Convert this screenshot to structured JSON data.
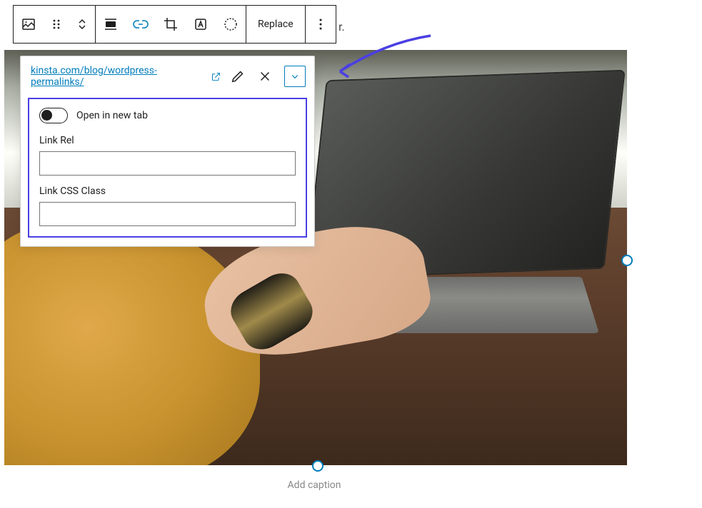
{
  "partial_text": "r.",
  "toolbar": {
    "image_icon": "image-icon",
    "drag_icon": "drag-icon",
    "move_icon": "move-icon",
    "align_icon": "align-icon",
    "link_icon": "link-icon",
    "crop_icon": "crop-icon",
    "alt_icon": "alt-text-icon",
    "duotone_icon": "duotone-icon",
    "replace_label": "Replace",
    "more_icon": "more-icon"
  },
  "popover": {
    "url": "kinsta.com/blog/wordpress-permalinks/",
    "settings": {
      "open_new_tab_label": "Open in new tab",
      "open_new_tab_value": false,
      "link_rel_label": "Link Rel",
      "link_rel_value": "",
      "link_css_class_label": "Link CSS Class",
      "link_css_class_value": ""
    }
  },
  "caption": "Add caption"
}
